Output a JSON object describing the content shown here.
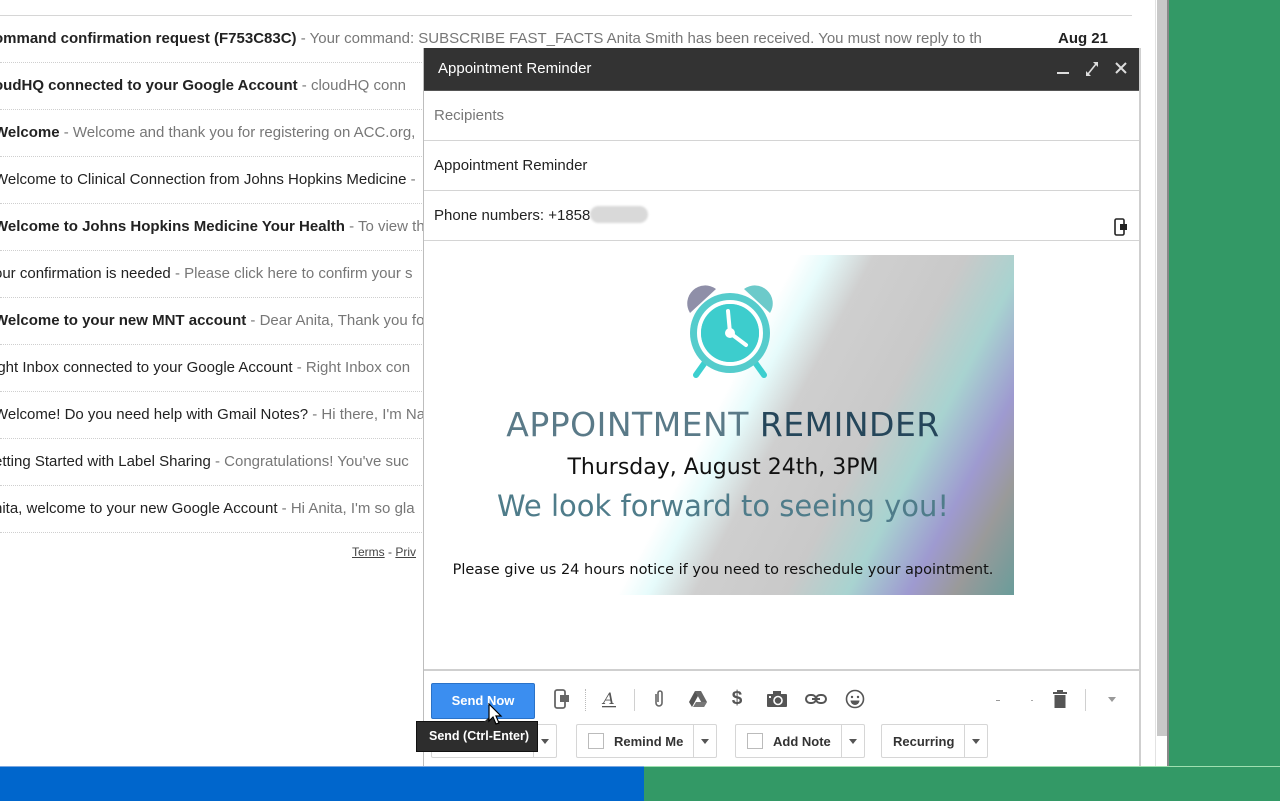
{
  "mail_list": {
    "rows": [
      {
        "subject": "ommand confirmation request (F753C83C)",
        "snippet": " - Your command: SUBSCRIBE FAST_FACTS Anita Smith has been received. You must now reply to th",
        "date": "Aug 21",
        "bold": true
      },
      {
        "subject": "oudHQ connected to your Google Account",
        "snippet": " - cloudHQ conn",
        "bold": true
      },
      {
        "subject": "Welcome",
        "snippet": " - Welcome and thank you for registering on ACC.org,",
        "bold": true
      },
      {
        "subject": "Welcome to Clinical Connection from Johns Hopkins Medicine",
        "snippet": " - ",
        "bold": false
      },
      {
        "subject": "Welcome to Johns Hopkins Medicine Your Health",
        "snippet": " - To view th",
        "bold": true
      },
      {
        "subject": "our confirmation is needed",
        "snippet": " - Please click here to confirm your s",
        "bold": false
      },
      {
        "subject": "Welcome to your new MNT account",
        "snippet": " - Dear Anita, Thank you fo",
        "bold": true
      },
      {
        "subject": "ight Inbox connected to your Google Account",
        "snippet": " - Right Inbox con",
        "bold": false
      },
      {
        "subject": "Welcome! Do you need help with Gmail Notes?",
        "snippet": " - Hi there, I'm Na",
        "bold": false
      },
      {
        "subject": "etting Started with Label Sharing",
        "snippet": " - Congratulations! You've suc",
        "bold": false
      },
      {
        "subject": "nita, welcome to your new Google Account",
        "snippet": " - Hi Anita, I'm so gla",
        "bold": false
      }
    ],
    "footer": {
      "terms": "Terms",
      "separator": " - ",
      "privacy": "Priv"
    }
  },
  "compose": {
    "title": "Appointment Reminder",
    "header_icons": [
      "minimize-icon",
      "expand-icon",
      "close-icon"
    ],
    "recipients_placeholder": "Recipients",
    "subject": "Appointment Reminder",
    "phone_label": "Phone numbers: +1858",
    "banner": {
      "title_light": "APPOINTMENT ",
      "title_dark": "REMINDER",
      "date_line": "Thursday, August 24th, 3PM",
      "tagline": "We look forward to seeing you!",
      "note": "Please give us 24 hours notice if you need to reschedule your apointment.",
      "colors": {
        "clock": "#3ccfcf",
        "clock_bell": "#8f8fa8",
        "title": "#5a7a88",
        "title_dark": "#25465a",
        "tagline": "#4f7c8a"
      }
    },
    "toolbar": {
      "send_label": "Send Now",
      "send_color": "#3b8ef0",
      "tooltip": "Send (Ctrl-Enter)",
      "icons": [
        "sms-icon",
        "text-format-icon",
        "attach-icon",
        "drive-icon",
        "dollar-icon",
        "camera-icon",
        "link-icon",
        "emoji-icon",
        "delete-icon",
        "more-options-icon"
      ]
    },
    "options": {
      "remind_me": "Remind Me",
      "add_note": "Add Note",
      "recurring": "Recurring"
    }
  },
  "colors": {
    "taskbar_left": "#0066cc",
    "desktop_right": "#339966",
    "compose_header": "#333333"
  }
}
